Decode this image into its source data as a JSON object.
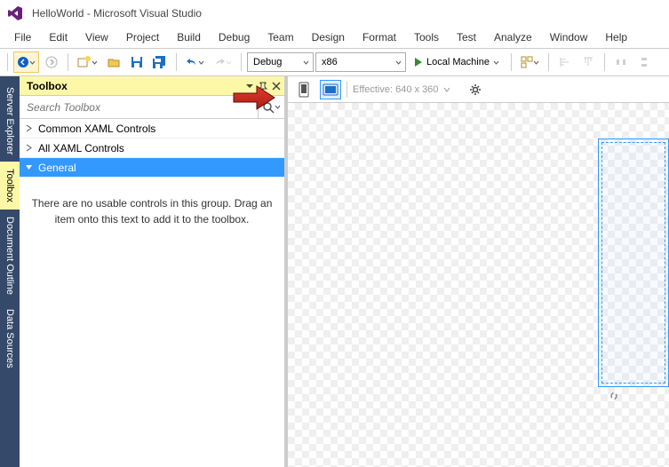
{
  "title": "HelloWorld - Microsoft Visual Studio",
  "menu": [
    "File",
    "Edit",
    "View",
    "Project",
    "Build",
    "Debug",
    "Team",
    "Design",
    "Format",
    "Tools",
    "Test",
    "Analyze",
    "Window",
    "Help"
  ],
  "toolbar": {
    "config": "Debug",
    "platform": "x86",
    "run_label": "Local Machine"
  },
  "side_tabs": [
    "Server Explorer",
    "Toolbox",
    "Document Outline",
    "Data Sources"
  ],
  "toolbox": {
    "title": "Toolbox",
    "search_placeholder": "Search Toolbox",
    "groups": [
      "Common XAML Controls",
      "All XAML Controls",
      "General"
    ],
    "empty_msg": "There are no usable controls in this group. Drag an item onto this text to add it to the toolbox."
  },
  "designer": {
    "effective_label": "Effective: 640 x 360"
  }
}
